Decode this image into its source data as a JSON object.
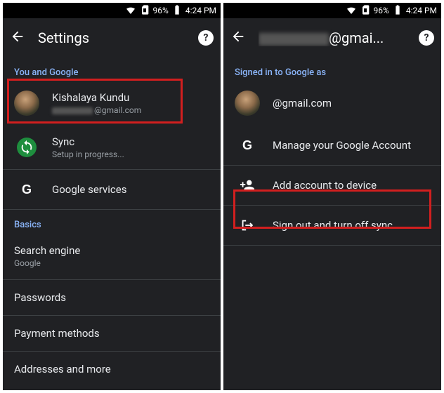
{
  "status": {
    "battery_pct": "96%",
    "time": "4:24 PM"
  },
  "left": {
    "title": "Settings",
    "section_account": "You and Google",
    "account_name": "Kishalaya Kundu",
    "account_email_suffix": "@gmail.com",
    "sync_label": "Sync",
    "sync_sub": "Setup in progress...",
    "gservices": "Google services",
    "section_basics": "Basics",
    "search_engine": "Search engine",
    "search_engine_sub": "Google",
    "passwords": "Passwords",
    "payment": "Payment methods",
    "addresses": "Addresses and more"
  },
  "right": {
    "title_suffix": "@gmai...",
    "signed_in": "Signed in to Google as",
    "email_suffix": "@gmail.com",
    "manage": "Manage your Google Account",
    "add_account": "Add account to device",
    "signout": "Sign out and turn off sync"
  }
}
